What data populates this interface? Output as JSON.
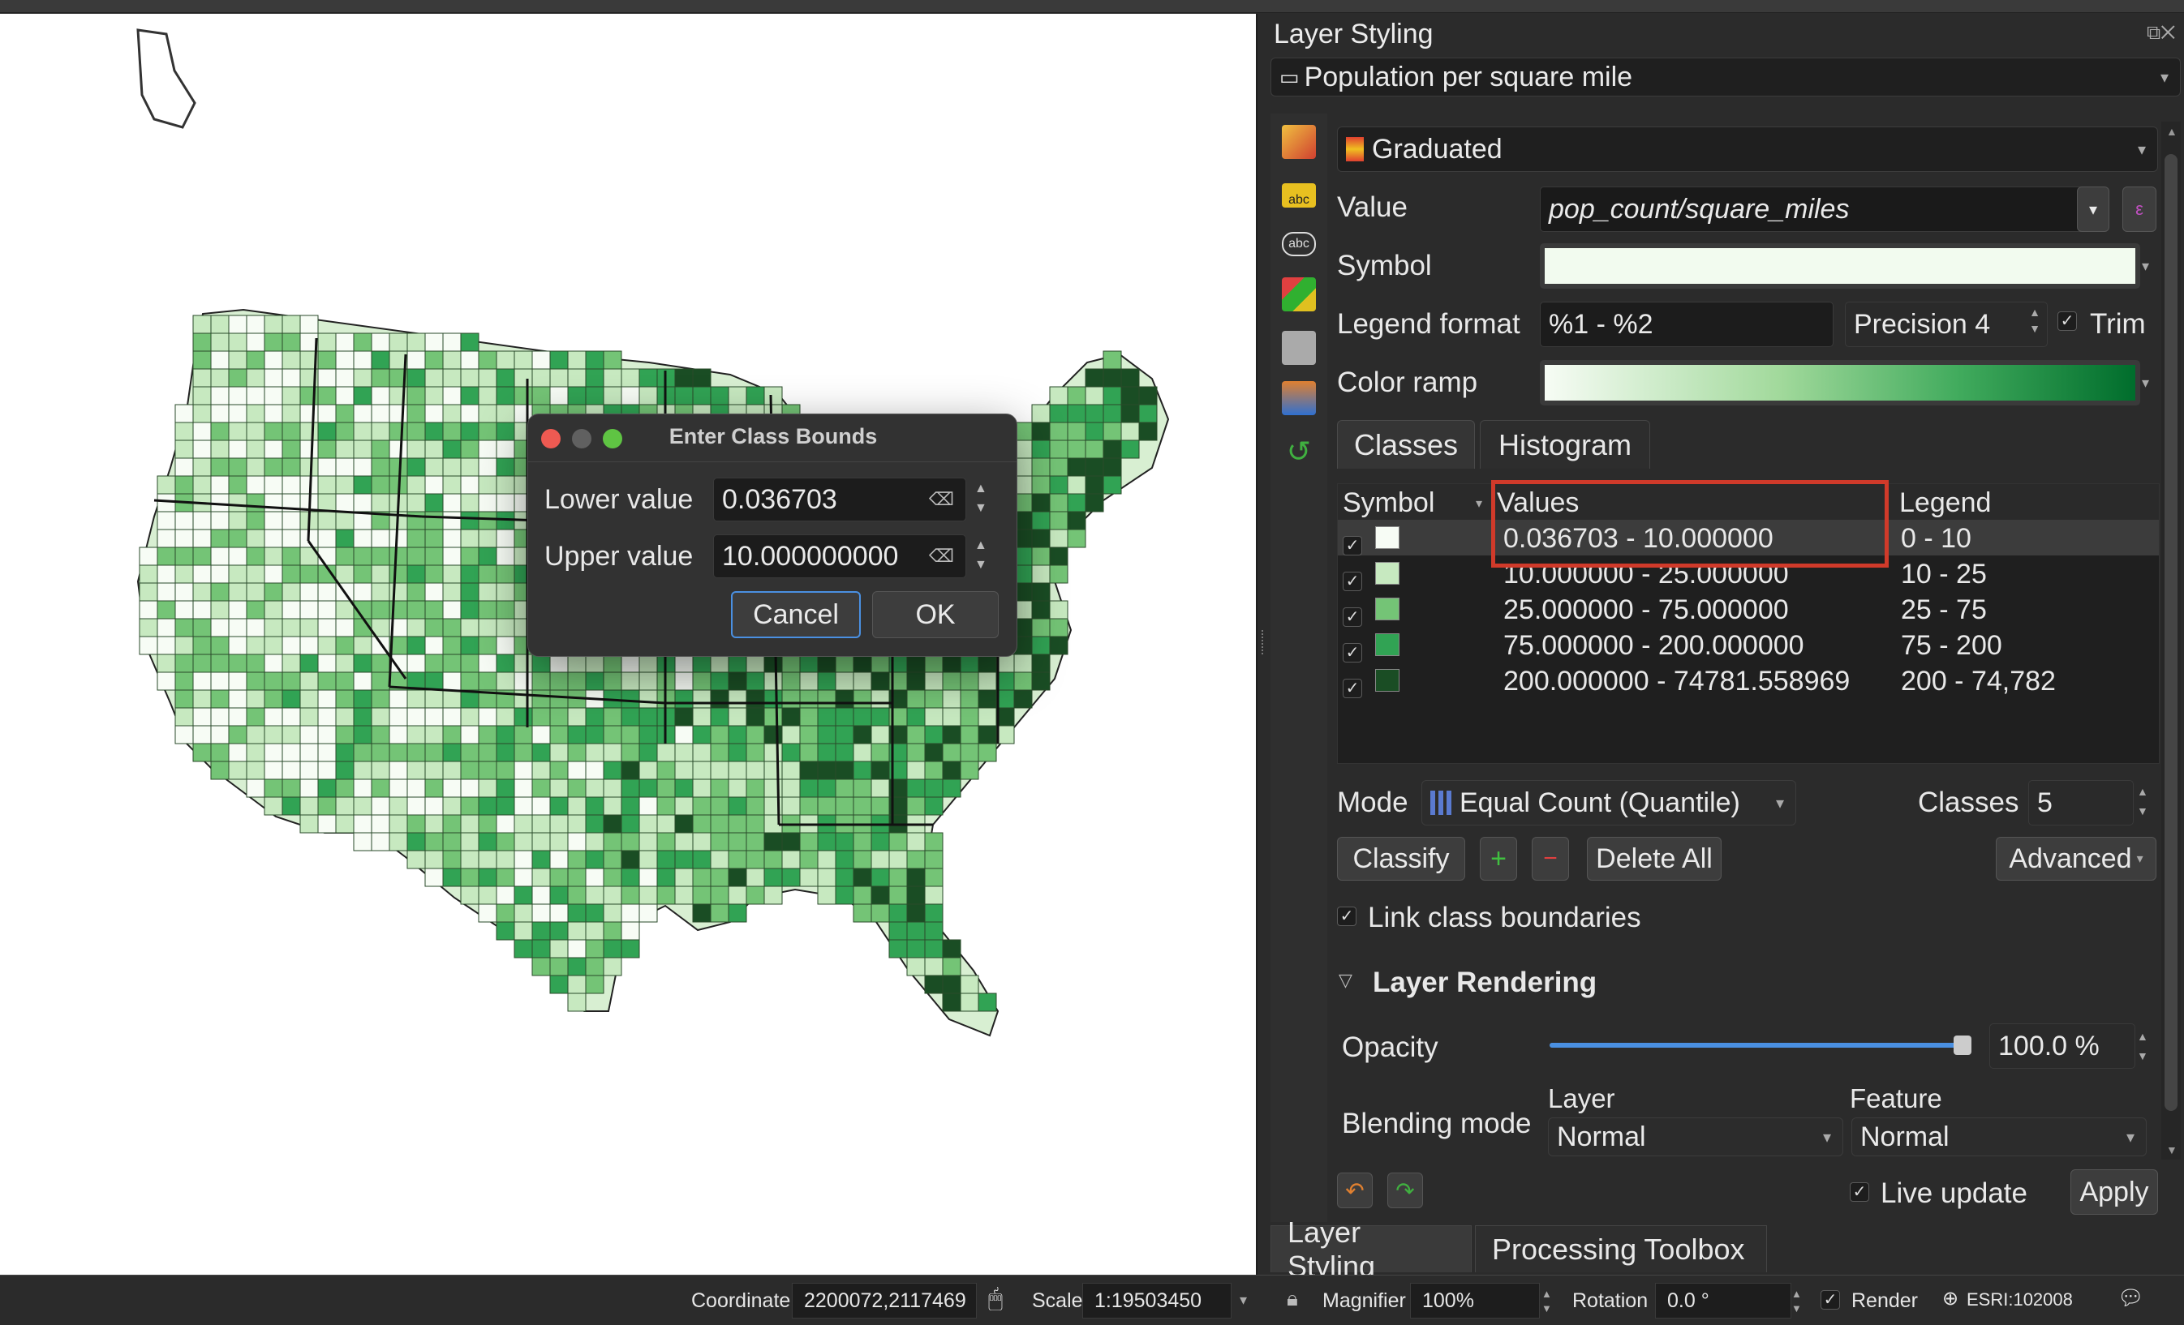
{
  "panel": {
    "title": "Layer Styling",
    "layer_name": "Population per square mile",
    "renderer": "Graduated",
    "value_label": "Value",
    "value_expression": "pop_count/square_miles",
    "symbol_label": "Symbol",
    "legend_format_label": "Legend format",
    "legend_format_value": "%1 - %2",
    "precision_label": "Precision 4",
    "trim_label": "Trim",
    "color_ramp_label": "Color ramp",
    "tabs": [
      "Classes",
      "Histogram"
    ],
    "table_headers": {
      "symbol": "Symbol",
      "values": "Values",
      "legend": "Legend"
    },
    "classes": [
      {
        "values": "0.036703 - 10.000000",
        "legend": "0 - 10",
        "color": "#f7fcf5"
      },
      {
        "values": "10.000000 - 25.000000",
        "legend": "10 - 25",
        "color": "#c7e9c0"
      },
      {
        "values": "25.000000 - 75.000000",
        "legend": "25 - 75",
        "color": "#74c476"
      },
      {
        "values": "75.000000 - 200.000000",
        "legend": "75 - 200",
        "color": "#31a354"
      },
      {
        "values": "200.000000 - 74781.558969",
        "legend": "200 - 74,782",
        "color": "#1a4d24"
      }
    ],
    "mode_label": "Mode",
    "mode_value": "Equal Count (Quantile)",
    "classes_label": "Classes",
    "classes_count": "5",
    "classify_button": "Classify",
    "delete_all_button": "Delete All",
    "advanced_button": "Advanced",
    "link_boundaries_label": "Link class boundaries",
    "layer_rendering_label": "Layer Rendering",
    "opacity_label": "Opacity",
    "opacity_value": "100.0 %",
    "opacity_fraction": 1.0,
    "blending_label": "Blending mode",
    "blend_layer_label": "Layer",
    "blend_feature_label": "Feature",
    "blend_layer_value": "Normal",
    "blend_feature_value": "Normal",
    "live_update_label": "Live update",
    "apply_button": "Apply"
  },
  "bottom_tabs": [
    "Layer Styling",
    "Processing Toolbox"
  ],
  "dialog": {
    "title": "Enter Class Bounds",
    "lower_label": "Lower value",
    "lower_value": "0.036703",
    "upper_label": "Upper value",
    "upper_value": "10.000000000",
    "cancel_button": "Cancel",
    "ok_button": "OK"
  },
  "statusbar": {
    "coordinate_label": "Coordinate",
    "coordinate_value": "2200072,2117469",
    "scale_label": "Scale",
    "scale_value": "1:19503450",
    "magnifier_label": "Magnifier",
    "magnifier_value": "100%",
    "rotation_label": "Rotation",
    "rotation_value": "0.0 °",
    "render_label": "Render",
    "crs_label": "ESRI:102008"
  },
  "colors": {
    "highlight_box": "#d03a2a",
    "accent_blue": "#4a90e2"
  },
  "icons": [
    "paintbrush-icon",
    "label-abc-icon",
    "label-abc-outline-icon",
    "3d-cube-icon",
    "diagram-icon",
    "fields-icon",
    "undo-icon",
    "redo-icon",
    "lock-icon",
    "globe-icon",
    "message-icon"
  ]
}
